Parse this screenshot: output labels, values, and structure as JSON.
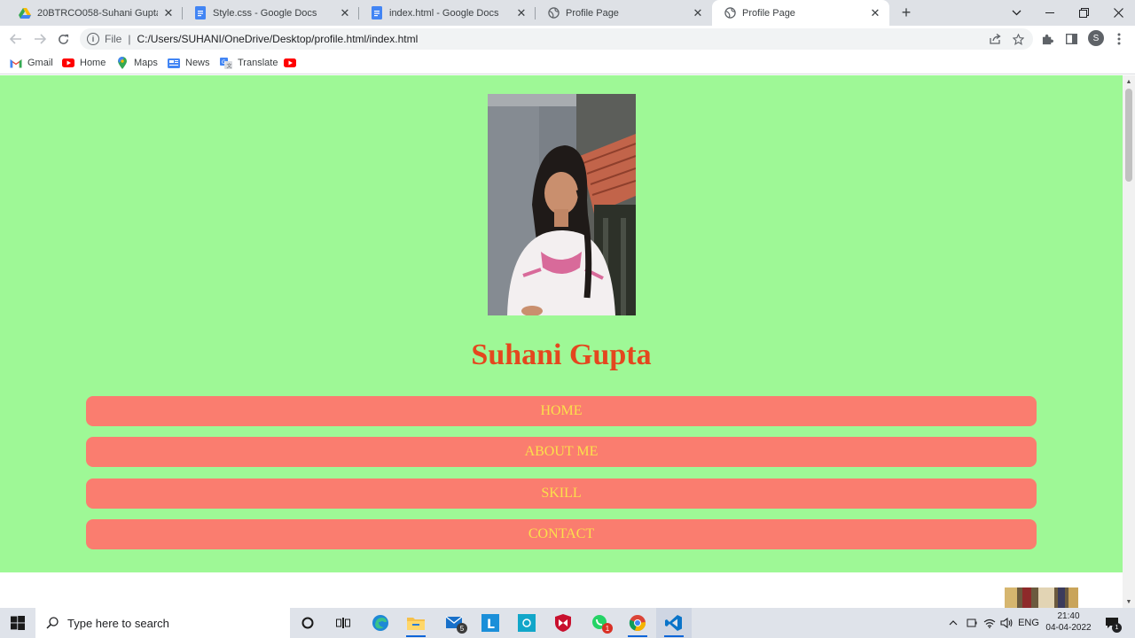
{
  "browser": {
    "tabs": [
      {
        "title": "20BTRCO058-Suhani Gupta - Goo",
        "icon": "google-drive-icon",
        "active": false
      },
      {
        "title": "Style.css - Google Docs",
        "icon": "google-docs-icon",
        "active": false
      },
      {
        "title": "index.html - Google Docs",
        "icon": "google-docs-icon",
        "active": false
      },
      {
        "title": "Profile Page",
        "icon": "globe-icon",
        "active": false
      },
      {
        "title": "Profile Page",
        "icon": "globe-icon",
        "active": true
      }
    ],
    "address": {
      "scheme_label": "File",
      "url": "C:/Users/SUHANI/OneDrive/Desktop/profile.html/index.html"
    },
    "profile_initial": "S",
    "bookmarks": [
      {
        "label": "Gmail",
        "icon": "gmail-icon"
      },
      {
        "label": "Home",
        "icon": "youtube-icon"
      },
      {
        "label": "Maps",
        "icon": "maps-icon"
      },
      {
        "label": "News",
        "icon": "news-icon"
      },
      {
        "label": "Translate",
        "icon": "translate-icon"
      },
      {
        "label": "",
        "icon": "youtube-icon"
      }
    ]
  },
  "page": {
    "name": "Suhani Gupta",
    "nav": [
      {
        "label": "HOME"
      },
      {
        "label": "ABOUT ME"
      },
      {
        "label": "SKILL"
      },
      {
        "label": "CONTACT"
      }
    ],
    "colors": {
      "background": "#9ef896",
      "name": "#e4471e",
      "button_bg": "#fa7d6f",
      "button_text": "#fbe04b"
    }
  },
  "taskbar": {
    "search_placeholder": "Type here to search",
    "mail_badge": "5",
    "opera_badge": "1",
    "language": "ENG",
    "time": "21:40",
    "date": "04-04-2022",
    "notification_count": "1"
  }
}
